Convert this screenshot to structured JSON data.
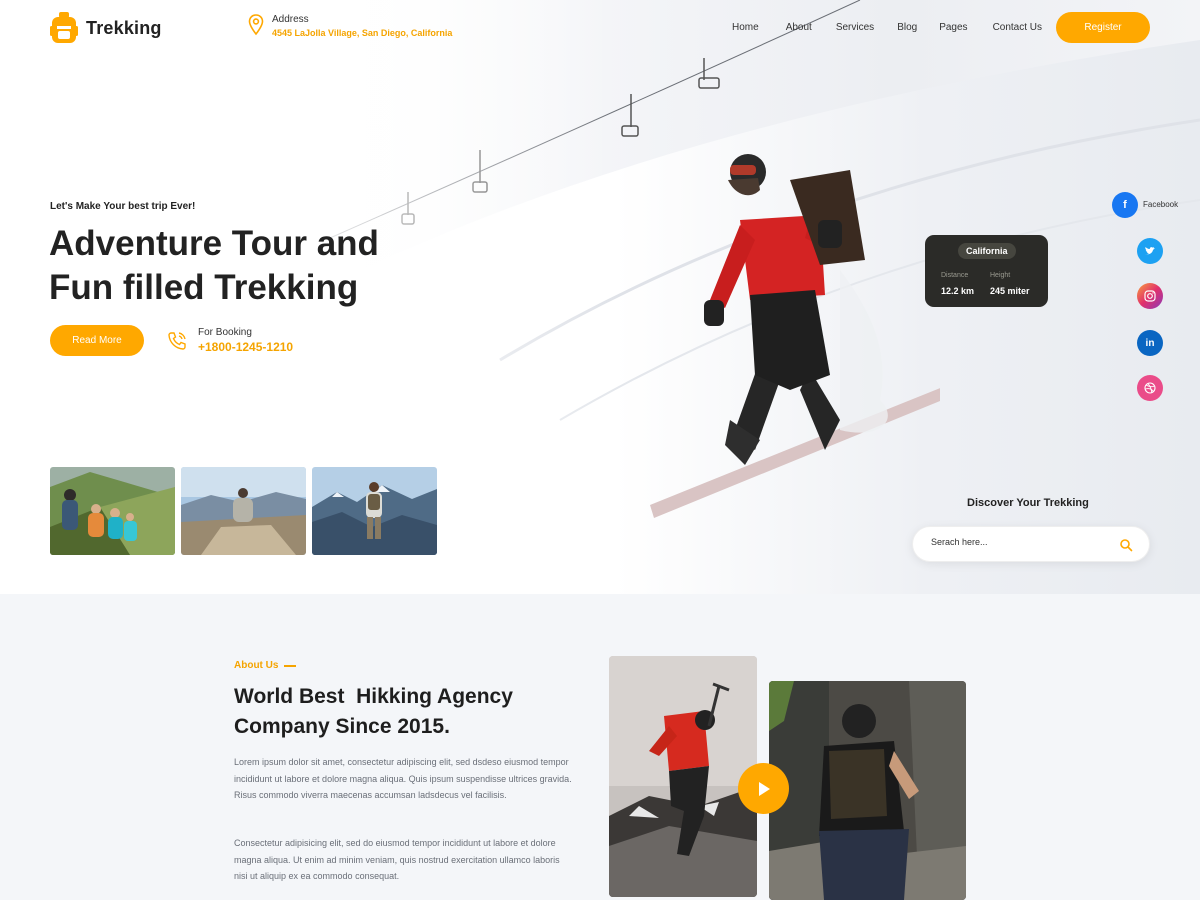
{
  "brand": {
    "name": "Trekking",
    "accent": "#ffa800"
  },
  "address": {
    "label": "Address",
    "value": "4545 LaJolla Village, San Diego, California"
  },
  "nav": {
    "items": [
      "Home",
      "About",
      "Services",
      "Blog",
      "Pages",
      "Contact Us"
    ],
    "register": "Register"
  },
  "hero": {
    "tagline": "Let's Make Your best trip Ever!",
    "title_line1": "Adventure Tour and",
    "title_line2": "Fun filled Trekking",
    "read_more": "Read More",
    "booking_label": "For Booking",
    "booking_phone": "+1800-1245-1210"
  },
  "info_card": {
    "location": "California",
    "distance_label": "Distance",
    "distance": "12.2 km",
    "height_label": "Height",
    "height": "245 miter"
  },
  "social": {
    "facebook_label": "Facebook",
    "icons": [
      "facebook-icon",
      "twitter-icon",
      "instagram-icon",
      "linkedin-icon",
      "dribbble-icon"
    ]
  },
  "discover": {
    "title": "Discover Your Trekking",
    "placeholder": "Serach here..."
  },
  "about": {
    "eyebrow": "About Us",
    "title_line1": "World Best  Hikking Agency",
    "title_line2": "Company Since 2015.",
    "p1": "Lorem ipsum dolor sit amet, consectetur adipiscing elit, sed dsdeso eiusmod tempor incididunt ut labore et dolore magna aliqua. Quis ipsum suspendisse ultrices gravida. Risus commodo viverra maecenas accumsan ladsdecus vel facilisis.",
    "p2": "Consectetur adipisicing elit, sed do eiusmod tempor incididunt ut labore et dolore magna aliqua. Ut enim ad minim veniam, quis nostrud exercitation ullamco laboris nisi ut aliquip ex ea commodo consequat."
  }
}
